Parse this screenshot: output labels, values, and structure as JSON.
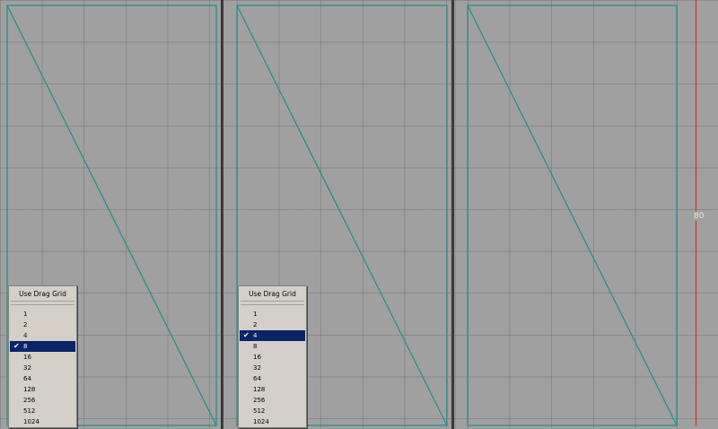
{
  "panels": [
    {
      "menu": {
        "header": "Use Drag Grid",
        "items": [
          "1",
          "2",
          "4",
          "8",
          "16",
          "32",
          "64",
          "128",
          "256",
          "512",
          "1024"
        ],
        "checked": "8"
      }
    },
    {
      "menu": {
        "header": "Use Drag Grid",
        "items": [
          "1",
          "2",
          "4",
          "8",
          "16",
          "32",
          "64",
          "128",
          "256",
          "512",
          "1024"
        ],
        "checked": "4"
      }
    },
    {
      "marker_label": "80"
    }
  ],
  "colors": {
    "outline": "#1e8f8a",
    "marker": "#e02020",
    "selection": "#0a246a",
    "background": "#a0a0a0"
  }
}
